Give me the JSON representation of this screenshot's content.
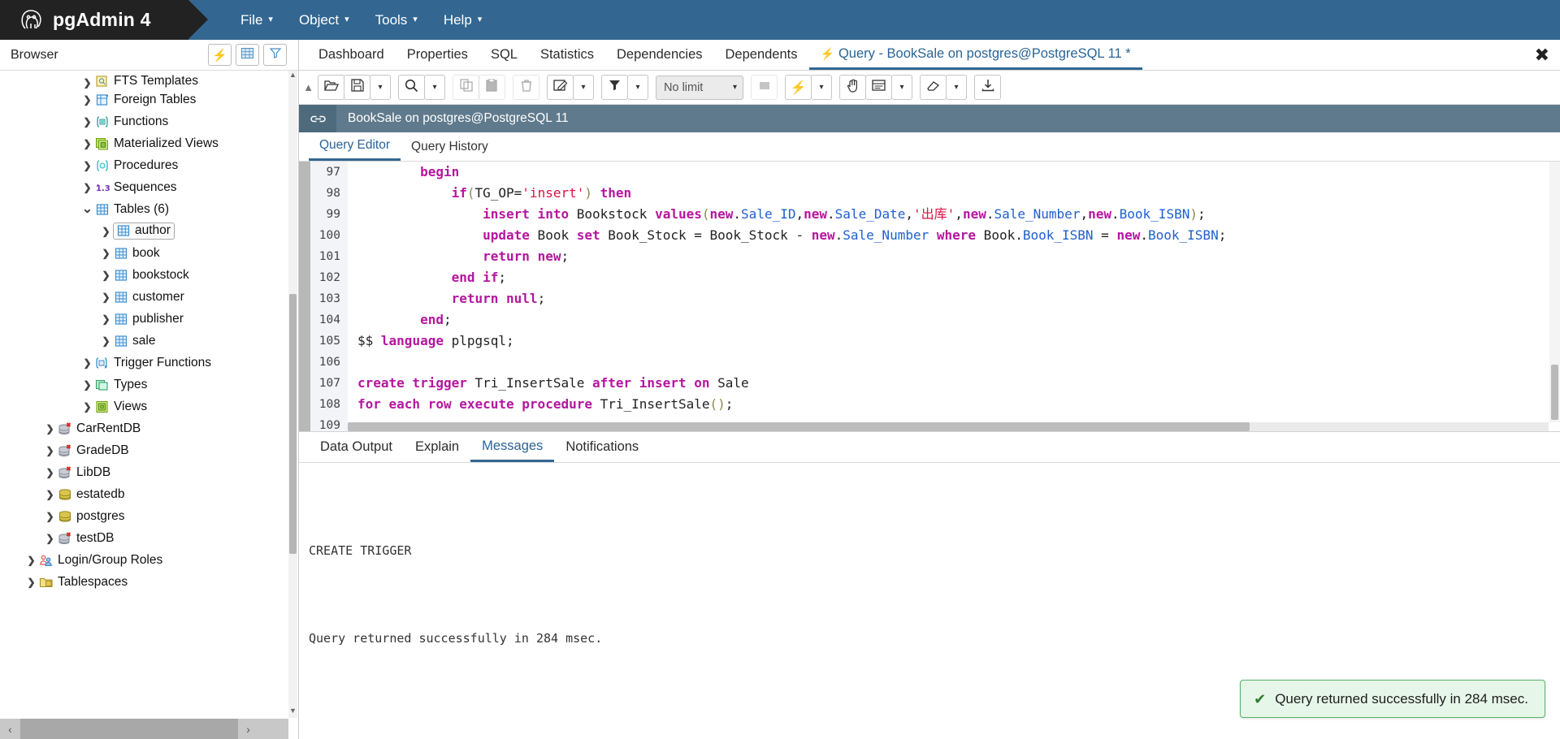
{
  "app": {
    "logo_icon": "elephant-logo",
    "name": "pgAdmin 4"
  },
  "menubar": {
    "items": [
      {
        "label": "File",
        "icon": "chevron-down-icon"
      },
      {
        "label": "Object",
        "icon": "chevron-down-icon"
      },
      {
        "label": "Tools",
        "icon": "chevron-down-icon"
      },
      {
        "label": "Help",
        "icon": "chevron-down-icon"
      }
    ],
    "caret": "▾"
  },
  "sidebar": {
    "title": "Browser",
    "buttons": [
      {
        "name": "query-tool-button",
        "icon": "bolt-icon",
        "glyph": "⚡"
      },
      {
        "name": "view-data-button",
        "icon": "grid-icon",
        "glyph": "▦"
      },
      {
        "name": "filter-button",
        "icon": "filter-icon",
        "glyph": "▼"
      }
    ],
    "tree": [
      {
        "label": "FTS Templates",
        "indent": 3,
        "state": "collapsed",
        "icon": "fts-template-icon",
        "clipped": true
      },
      {
        "label": "Foreign Tables",
        "indent": 3,
        "state": "collapsed",
        "icon": "foreign-table-icon"
      },
      {
        "label": "Functions",
        "indent": 3,
        "state": "collapsed",
        "icon": "function-icon"
      },
      {
        "label": "Materialized Views",
        "indent": 3,
        "state": "collapsed",
        "icon": "materialized-view-icon"
      },
      {
        "label": "Procedures",
        "indent": 3,
        "state": "collapsed",
        "icon": "procedure-icon"
      },
      {
        "label": "Sequences",
        "indent": 3,
        "state": "collapsed",
        "icon": "sequence-icon"
      },
      {
        "label": "Tables (6)",
        "indent": 3,
        "state": "expanded",
        "icon": "tables-icon"
      },
      {
        "label": "author",
        "indent": 4,
        "state": "collapsed",
        "icon": "table-icon",
        "selected": true
      },
      {
        "label": "book",
        "indent": 4,
        "state": "collapsed",
        "icon": "table-icon"
      },
      {
        "label": "bookstock",
        "indent": 4,
        "state": "collapsed",
        "icon": "table-icon"
      },
      {
        "label": "customer",
        "indent": 4,
        "state": "collapsed",
        "icon": "table-icon"
      },
      {
        "label": "publisher",
        "indent": 4,
        "state": "collapsed",
        "icon": "table-icon"
      },
      {
        "label": "sale",
        "indent": 4,
        "state": "collapsed",
        "icon": "table-icon"
      },
      {
        "label": "Trigger Functions",
        "indent": 3,
        "state": "collapsed",
        "icon": "trigger-function-icon"
      },
      {
        "label": "Types",
        "indent": 3,
        "state": "collapsed",
        "icon": "type-icon"
      },
      {
        "label": "Views",
        "indent": 3,
        "state": "collapsed",
        "icon": "view-icon"
      },
      {
        "label": "CarRentDB",
        "indent": 1,
        "state": "collapsed",
        "icon": "database-disconnected-icon"
      },
      {
        "label": "GradeDB",
        "indent": 1,
        "state": "collapsed",
        "icon": "database-disconnected-icon"
      },
      {
        "label": "LibDB",
        "indent": 1,
        "state": "collapsed",
        "icon": "database-disconnected-icon"
      },
      {
        "label": "estatedb",
        "indent": 1,
        "state": "collapsed",
        "icon": "database-connected-icon"
      },
      {
        "label": "postgres",
        "indent": 1,
        "state": "collapsed",
        "icon": "database-connected-icon"
      },
      {
        "label": "testDB",
        "indent": 1,
        "state": "collapsed",
        "icon": "database-disconnected-icon"
      },
      {
        "label": "Login/Group Roles",
        "indent": 0,
        "state": "collapsed",
        "icon": "roles-icon"
      },
      {
        "label": "Tablespaces",
        "indent": 0,
        "state": "collapsed",
        "icon": "tablespace-icon"
      }
    ]
  },
  "main_tabs": {
    "items": [
      {
        "label": "Dashboard",
        "active": false
      },
      {
        "label": "Properties",
        "active": false
      },
      {
        "label": "SQL",
        "active": false
      },
      {
        "label": "Statistics",
        "active": false
      },
      {
        "label": "Dependencies",
        "active": false
      },
      {
        "label": "Dependents",
        "active": false
      }
    ],
    "query_tab": {
      "label": "Query - BookSale on postgres@PostgreSQL 11 *",
      "bolt": "⚡",
      "active": true
    },
    "close_glyph": "✖"
  },
  "query_toolbar": {
    "buttons": [
      {
        "name": "open-file-button",
        "icon": "open-folder-icon",
        "glyph": "🗁",
        "disabled": false
      },
      {
        "name": "save-file-button",
        "icon": "save-icon",
        "glyph": "💾",
        "disabled": false
      },
      {
        "name": "save-dropdown-button",
        "icon": "chevron-down-icon",
        "glyph": "▾",
        "disabled": false
      },
      {
        "name": "find-button",
        "icon": "search-icon",
        "glyph": "🔍",
        "disabled": false
      },
      {
        "name": "find-dropdown-button",
        "icon": "chevron-down-icon",
        "glyph": "▾",
        "disabled": false
      },
      {
        "name": "copy-button",
        "icon": "copy-icon",
        "glyph": "⧉",
        "disabled": true
      },
      {
        "name": "paste-button",
        "icon": "paste-icon",
        "glyph": "📋",
        "disabled": true
      },
      {
        "name": "delete-button",
        "icon": "trash-icon",
        "glyph": "🗑",
        "disabled": true
      },
      {
        "name": "edit-button",
        "icon": "edit-pencil-icon",
        "glyph": "✎",
        "disabled": false
      },
      {
        "name": "edit-dropdown-button",
        "icon": "chevron-down-icon",
        "glyph": "▾",
        "disabled": false
      },
      {
        "name": "filter-button",
        "icon": "filter-icon",
        "glyph": "▼",
        "disabled": false
      },
      {
        "name": "filter-dropdown-button",
        "icon": "chevron-down-icon",
        "glyph": "▾",
        "disabled": false
      }
    ],
    "limit_select": {
      "value": "No limit",
      "caret": "▾"
    },
    "buttons_right": [
      {
        "name": "stop-button",
        "icon": "stop-square-icon",
        "glyph": "■",
        "disabled": true
      },
      {
        "name": "execute-button",
        "icon": "bolt-icon",
        "glyph": "⚡",
        "disabled": false
      },
      {
        "name": "execute-dropdown-button",
        "icon": "chevron-down-icon",
        "glyph": "▾",
        "disabled": false
      },
      {
        "name": "explain-button",
        "icon": "hand-icon",
        "glyph": "✋",
        "disabled": false
      },
      {
        "name": "explain-analyze-button",
        "icon": "panel-icon",
        "glyph": "▤",
        "disabled": false
      },
      {
        "name": "explain-options-button",
        "icon": "chevron-down-icon",
        "glyph": "▾",
        "disabled": false
      },
      {
        "name": "macros-button",
        "icon": "eraser-icon",
        "glyph": "✐",
        "disabled": false
      },
      {
        "name": "macros-dropdown-button",
        "icon": "chevron-down-icon",
        "glyph": "▾",
        "disabled": false
      },
      {
        "name": "download-button",
        "icon": "download-icon",
        "glyph": "⤓",
        "disabled": false
      }
    ]
  },
  "connection_bar": {
    "icon": "connection-link-icon",
    "text": "BookSale on postgres@PostgreSQL 11"
  },
  "editor_tabs": {
    "items": [
      {
        "label": "Query Editor",
        "active": true
      },
      {
        "label": "Query History",
        "active": false
      }
    ]
  },
  "editor": {
    "first_line": 97,
    "lines": [
      {
        "n": 97,
        "tokens": [
          {
            "t": "        ",
            "c": "plain"
          },
          {
            "t": "begin",
            "c": "kw"
          }
        ],
        "clipped_top": true
      },
      {
        "n": 98,
        "tokens": [
          {
            "t": "            ",
            "c": "plain"
          },
          {
            "t": "if",
            "c": "kw"
          },
          {
            "t": "(",
            "c": "punct"
          },
          {
            "t": "TG_OP=",
            "c": "plain"
          },
          {
            "t": "'insert'",
            "c": "str"
          },
          {
            "t": ")",
            "c": "punct"
          },
          {
            "t": " ",
            "c": "plain"
          },
          {
            "t": "then",
            "c": "kw"
          }
        ]
      },
      {
        "n": 99,
        "tokens": [
          {
            "t": "                ",
            "c": "plain"
          },
          {
            "t": "insert into",
            "c": "kw"
          },
          {
            "t": " Bookstock ",
            "c": "plain"
          },
          {
            "t": "values",
            "c": "kw"
          },
          {
            "t": "(",
            "c": "punct"
          },
          {
            "t": "new",
            "c": "nv"
          },
          {
            "t": ".",
            "c": "plain"
          },
          {
            "t": "Sale_ID",
            "c": "col"
          },
          {
            "t": ",",
            "c": "plain"
          },
          {
            "t": "new",
            "c": "nv"
          },
          {
            "t": ".",
            "c": "plain"
          },
          {
            "t": "Sale_Date",
            "c": "col"
          },
          {
            "t": ",",
            "c": "plain"
          },
          {
            "t": "'出库'",
            "c": "str"
          },
          {
            "t": ",",
            "c": "plain"
          },
          {
            "t": "new",
            "c": "nv"
          },
          {
            "t": ".",
            "c": "plain"
          },
          {
            "t": "Sale_Number",
            "c": "col"
          },
          {
            "t": ",",
            "c": "plain"
          },
          {
            "t": "new",
            "c": "nv"
          },
          {
            "t": ".",
            "c": "plain"
          },
          {
            "t": "Book_ISBN",
            "c": "col"
          },
          {
            "t": ")",
            "c": "punct"
          },
          {
            "t": ";",
            "c": "plain"
          }
        ]
      },
      {
        "n": 100,
        "tokens": [
          {
            "t": "                ",
            "c": "plain"
          },
          {
            "t": "update",
            "c": "kw"
          },
          {
            "t": " Book ",
            "c": "plain"
          },
          {
            "t": "set",
            "c": "kw"
          },
          {
            "t": " Book_Stock = Book_Stock - ",
            "c": "plain"
          },
          {
            "t": "new",
            "c": "nv"
          },
          {
            "t": ".",
            "c": "plain"
          },
          {
            "t": "Sale_Number",
            "c": "col"
          },
          {
            "t": " ",
            "c": "plain"
          },
          {
            "t": "where",
            "c": "kw"
          },
          {
            "t": " Book.",
            "c": "plain"
          },
          {
            "t": "Book_ISBN",
            "c": "col"
          },
          {
            "t": " = ",
            "c": "plain"
          },
          {
            "t": "new",
            "c": "nv"
          },
          {
            "t": ".",
            "c": "plain"
          },
          {
            "t": "Book_ISBN",
            "c": "col"
          },
          {
            "t": ";",
            "c": "plain"
          }
        ]
      },
      {
        "n": 101,
        "tokens": [
          {
            "t": "                ",
            "c": "plain"
          },
          {
            "t": "return",
            "c": "kw"
          },
          {
            "t": " ",
            "c": "plain"
          },
          {
            "t": "new",
            "c": "nv"
          },
          {
            "t": ";",
            "c": "plain"
          }
        ]
      },
      {
        "n": 102,
        "tokens": [
          {
            "t": "            ",
            "c": "plain"
          },
          {
            "t": "end if",
            "c": "kw"
          },
          {
            "t": ";",
            "c": "plain"
          }
        ]
      },
      {
        "n": 103,
        "tokens": [
          {
            "t": "            ",
            "c": "plain"
          },
          {
            "t": "return",
            "c": "kw"
          },
          {
            "t": " ",
            "c": "plain"
          },
          {
            "t": "null",
            "c": "kw"
          },
          {
            "t": ";",
            "c": "plain"
          }
        ]
      },
      {
        "n": 104,
        "tokens": [
          {
            "t": "        ",
            "c": "plain"
          },
          {
            "t": "end",
            "c": "kw"
          },
          {
            "t": ";",
            "c": "plain"
          }
        ]
      },
      {
        "n": 105,
        "tokens": [
          {
            "t": "$$ ",
            "c": "plain"
          },
          {
            "t": "language",
            "c": "kw"
          },
          {
            "t": " plpgsql;",
            "c": "plain"
          }
        ]
      },
      {
        "n": 106,
        "tokens": []
      },
      {
        "n": 107,
        "highlight": true,
        "tokens": [
          {
            "t": "create trigger",
            "c": "kw"
          },
          {
            "t": " Tri_InsertSale ",
            "c": "plain"
          },
          {
            "t": "after insert on",
            "c": "kw"
          },
          {
            "t": " Sale",
            "c": "plain"
          }
        ]
      },
      {
        "n": 108,
        "highlight": true,
        "tokens": [
          {
            "t": "for each row execute procedure",
            "c": "kw"
          },
          {
            "t": " Tri_InsertSale",
            "c": "plain"
          },
          {
            "t": "()",
            "c": "punct"
          },
          {
            "t": ";",
            "c": "plain"
          }
        ]
      },
      {
        "n": 109,
        "tokens": []
      }
    ]
  },
  "output_tabs": {
    "items": [
      {
        "label": "Data Output",
        "active": false
      },
      {
        "label": "Explain",
        "active": false
      },
      {
        "label": "Messages",
        "active": true
      },
      {
        "label": "Notifications",
        "active": false
      }
    ]
  },
  "messages": {
    "line1": "CREATE TRIGGER",
    "line2": "Query returned successfully in 284 msec."
  },
  "toast": {
    "check": "✔",
    "text": "Query returned successfully in 284 msec.",
    "border_color": "#58b368",
    "background_color": "#e6f6e8"
  },
  "colors": {
    "brand_blue": "#336791",
    "brand_dark": "#222222",
    "accent_tab": "#2a6496",
    "connbar": "#5f7a8c"
  }
}
